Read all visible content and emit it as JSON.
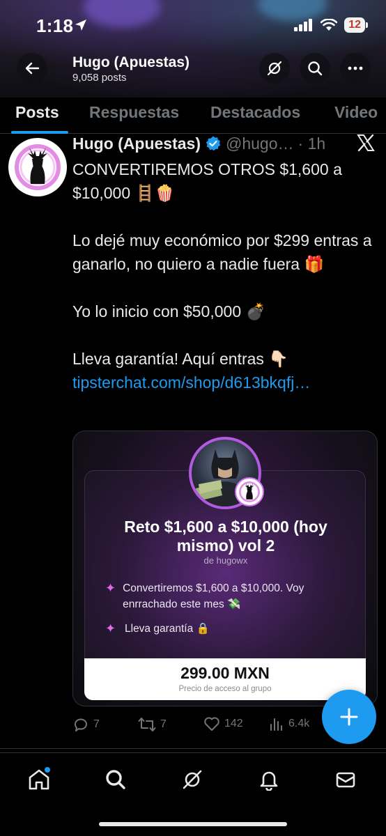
{
  "status_bar": {
    "time": "1:18",
    "battery": "12"
  },
  "profile": {
    "name": "Hugo (Apuestas)",
    "posts_count": "9,058 posts"
  },
  "tabs": [
    {
      "label": "Posts",
      "active": true
    },
    {
      "label": "Respuestas",
      "active": false
    },
    {
      "label": "Destacados",
      "active": false
    },
    {
      "label": "Video",
      "active": false
    }
  ],
  "post": {
    "author_name": "Hugo (Apuestas)",
    "author_handle": "@hugo…",
    "time": "· 1h",
    "lines": {
      "p1": "CONVERTIREMOS OTROS $1,600 a $10,000 🪜🍿",
      "p2": "Lo dejé muy económico por $299 entras a ganarlo, no quiero a nadie fuera 🎁",
      "p3": "Yo lo inicio con $50,000 💣",
      "p4": "Lleva garantía! Aquí entras 👇🏻"
    },
    "link": "tipsterchat.com/shop/d613bkqfj…",
    "card": {
      "title": "Reto $1,600 a $10,000 (hoy mismo) vol 2",
      "subtitle": "de hugowx",
      "features": [
        "Convertiremos $1,600 a $10,000. Voy enrrachado este mes 💸",
        "Lleva garantía 🔒"
      ],
      "price": "299.00 MXN",
      "price_caption": "Precio de acceso al grupo"
    },
    "actions": {
      "replies": "7",
      "reposts": "7",
      "likes": "142",
      "views": "6.4k"
    }
  },
  "colors": {
    "accent": "#1d9bf0",
    "muted": "#71767b",
    "background": "#000000"
  }
}
